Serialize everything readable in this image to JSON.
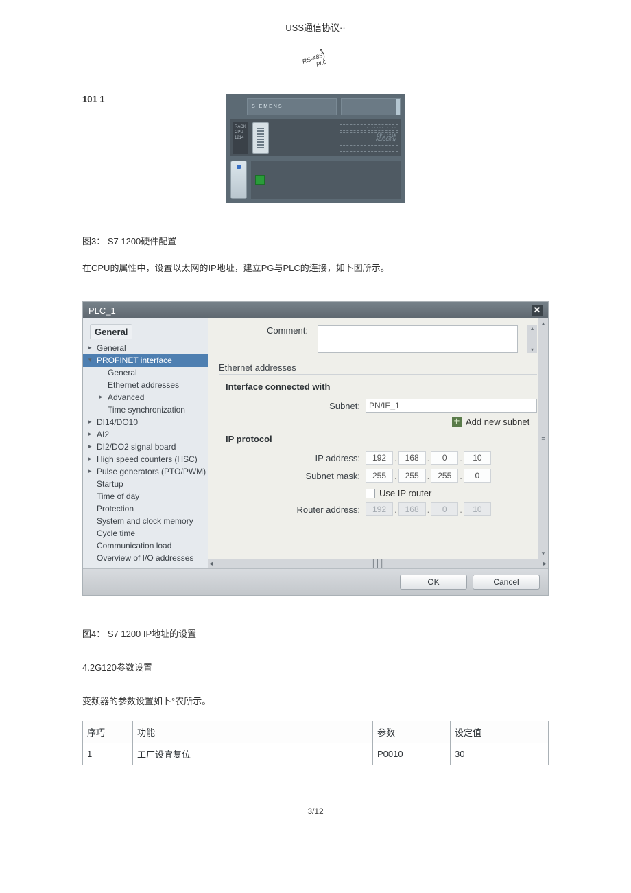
{
  "header": "USS通信协议··",
  "label101": "101 1",
  "fig3_caption": "图3：  S7 1200硬件配置",
  "fig3_para": "在CPU的属性中，设置以太网的IP地址，建立PG与PLC的连接，如卜图所示。",
  "dialog": {
    "title": "PLC_1",
    "tab": "General",
    "nav": {
      "general": "General",
      "profinet": "PROFINET interface",
      "sub_general": "General",
      "eth_addr": "Ethernet addresses",
      "advanced": "Advanced",
      "timesync": "Time synchronization",
      "di14": "DI14/DO10",
      "ai2": "AI2",
      "di2do2": "DI2/DO2 signal board",
      "hsc": "High speed counters (HSC)",
      "pto": "Pulse generators (PTO/PWM)",
      "startup": "Startup",
      "tod": "Time of day",
      "protection": "Protection",
      "sysclock": "System and clock memory",
      "cycle": "Cycle time",
      "commload": "Communication load",
      "ioover": "Overview of I/O addresses"
    },
    "right": {
      "comment_label": "Comment:",
      "eth_addresses": "Ethernet addresses",
      "iface_connected": "Interface connected with",
      "subnet_label": "Subnet:",
      "subnet_value": "PN/IE_1",
      "add_new_subnet": "Add new subnet",
      "ip_protocol": "IP protocol",
      "ip_address_label": "IP address:",
      "ip": {
        "o1": "192",
        "o2": "168",
        "o3": "0",
        "o4": "10"
      },
      "subnet_mask_label": "Subnet mask:",
      "mask": {
        "o1": "255",
        "o2": "255",
        "o3": "255",
        "o4": "0"
      },
      "use_ip_router": "Use IP router",
      "router_label": "Router address:",
      "router": {
        "o1": "192",
        "o2": "168",
        "o3": "0",
        "o4": "10"
      }
    },
    "buttons": {
      "ok": "OK",
      "cancel": "Cancel"
    }
  },
  "fig4_caption": "图4：  S7 1200 IP地址的设置",
  "section42": "4.2G120参数设置",
  "section42_line": "变频器的参数设置如卜°农所示。",
  "table": {
    "headers": {
      "sn": "序巧",
      "fn": "功能",
      "par": "参数",
      "val": "设定值"
    },
    "rows": [
      {
        "sn": "1",
        "fn": "工厂设宜复位",
        "par": "P0010",
        "val": "30"
      }
    ]
  },
  "hw": {
    "siemens": "SIEMENS",
    "label1": "RS-485",
    "label2": "PLC"
  },
  "pagenum": "3/12"
}
